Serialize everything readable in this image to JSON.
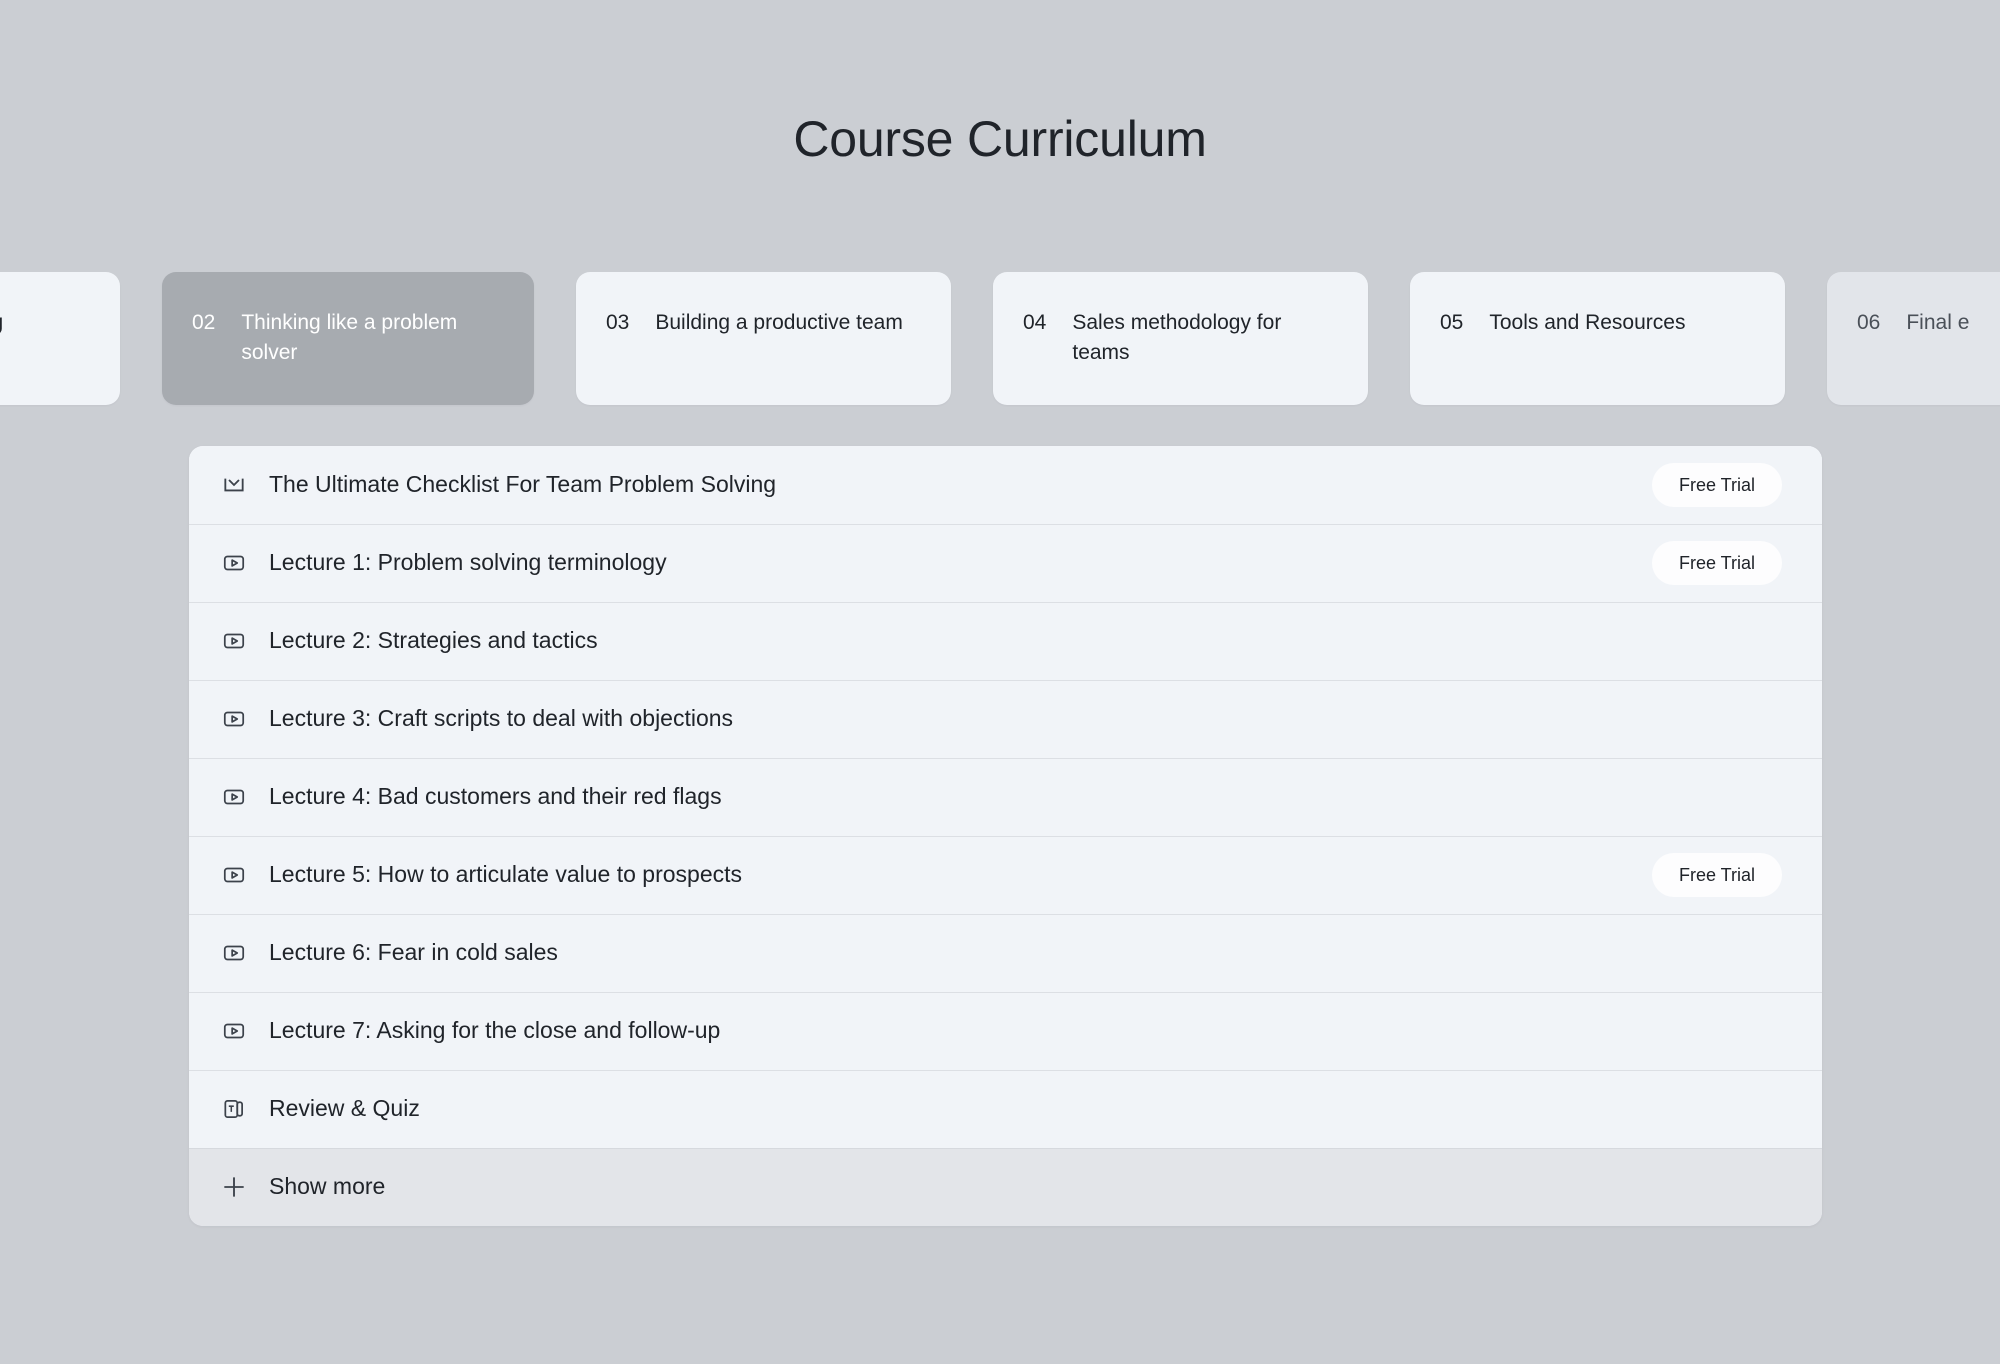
{
  "page": {
    "title": "Course Curriculum",
    "background_color": "#cbced3"
  },
  "tabs": {
    "active_index": 1,
    "items": [
      {
        "number": "",
        "label": "tening",
        "state": "clipped-left"
      },
      {
        "number": "02",
        "label": "Thinking like a problem solver",
        "state": "active"
      },
      {
        "number": "03",
        "label": "Building a productive team",
        "state": "default"
      },
      {
        "number": "04",
        "label": "Sales methodology for teams",
        "state": "default"
      },
      {
        "number": "05",
        "label": "Tools and Resources",
        "state": "default"
      },
      {
        "number": "06",
        "label": "Final e",
        "state": "faded-clipped-right"
      }
    ]
  },
  "lessons": {
    "badge_label": "Free Trial",
    "items": [
      {
        "icon": "download-icon",
        "title": "The Ultimate Checklist For Team Problem Solving",
        "badge": "Free Trial"
      },
      {
        "icon": "video-play-icon",
        "title": "Lecture 1: Problem solving terminology",
        "badge": "Free Trial"
      },
      {
        "icon": "video-play-icon",
        "title": "Lecture 2: Strategies and tactics",
        "badge": ""
      },
      {
        "icon": "video-play-icon",
        "title": "Lecture 3: Craft scripts to deal with objections",
        "badge": ""
      },
      {
        "icon": "video-play-icon",
        "title": "Lecture 4: Bad customers and their red flags",
        "badge": ""
      },
      {
        "icon": "video-play-icon",
        "title": "Lecture 5: How to articulate value to prospects",
        "badge": "Free Trial"
      },
      {
        "icon": "video-play-icon",
        "title": "Lecture 6: Fear in cold sales",
        "badge": ""
      },
      {
        "icon": "video-play-icon",
        "title": "Lecture 7: Asking for the close and follow-up",
        "badge": ""
      },
      {
        "icon": "text-quiz-icon",
        "title": "Review & Quiz",
        "badge": ""
      }
    ],
    "show_more": {
      "icon": "plus-icon",
      "label": "Show more"
    }
  },
  "colors": {
    "page_background": "#cbced3",
    "row_background": "#f1f4f8",
    "active_tab": "#a7abb0",
    "show_more_background": "#e3e5e9",
    "badge_background": "#fdfdfe",
    "text_primary": "#20242a",
    "divider": "#dcdfe4"
  }
}
